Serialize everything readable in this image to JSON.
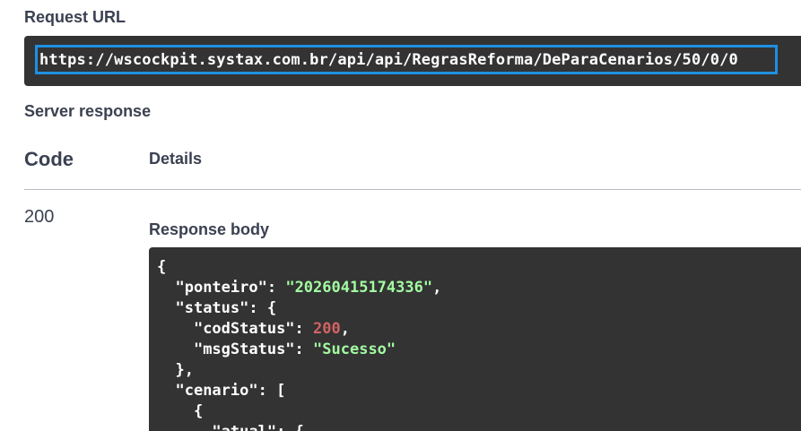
{
  "request_url": {
    "label": "Request URL",
    "url": "https://wscockpit.systax.com.br/api/api/RegrasReforma/DeParaCenarios/50/0/0"
  },
  "server_response": {
    "label": "Server response",
    "code_header": "Code",
    "details_header": "Details",
    "status_code": "200",
    "response_body_label": "Response body",
    "json": {
      "open_brace": "{",
      "ponteiro_key": "\"ponteiro\"",
      "ponteiro_value": "\"20260415174336\"",
      "status_key": "\"status\"",
      "codStatus_key": "\"codStatus\"",
      "codStatus_value": "200",
      "msgStatus_key": "\"msgStatus\"",
      "msgStatus_value": "\"Sucesso\"",
      "cenario_key": "\"cenario\"",
      "atual_key": "\"atual\""
    }
  },
  "colors": {
    "text": "#3b4151",
    "code_bg": "#333333",
    "url_highlight": "#1e90e0",
    "json_string": "#a2fca2",
    "json_number": "#d36363"
  }
}
